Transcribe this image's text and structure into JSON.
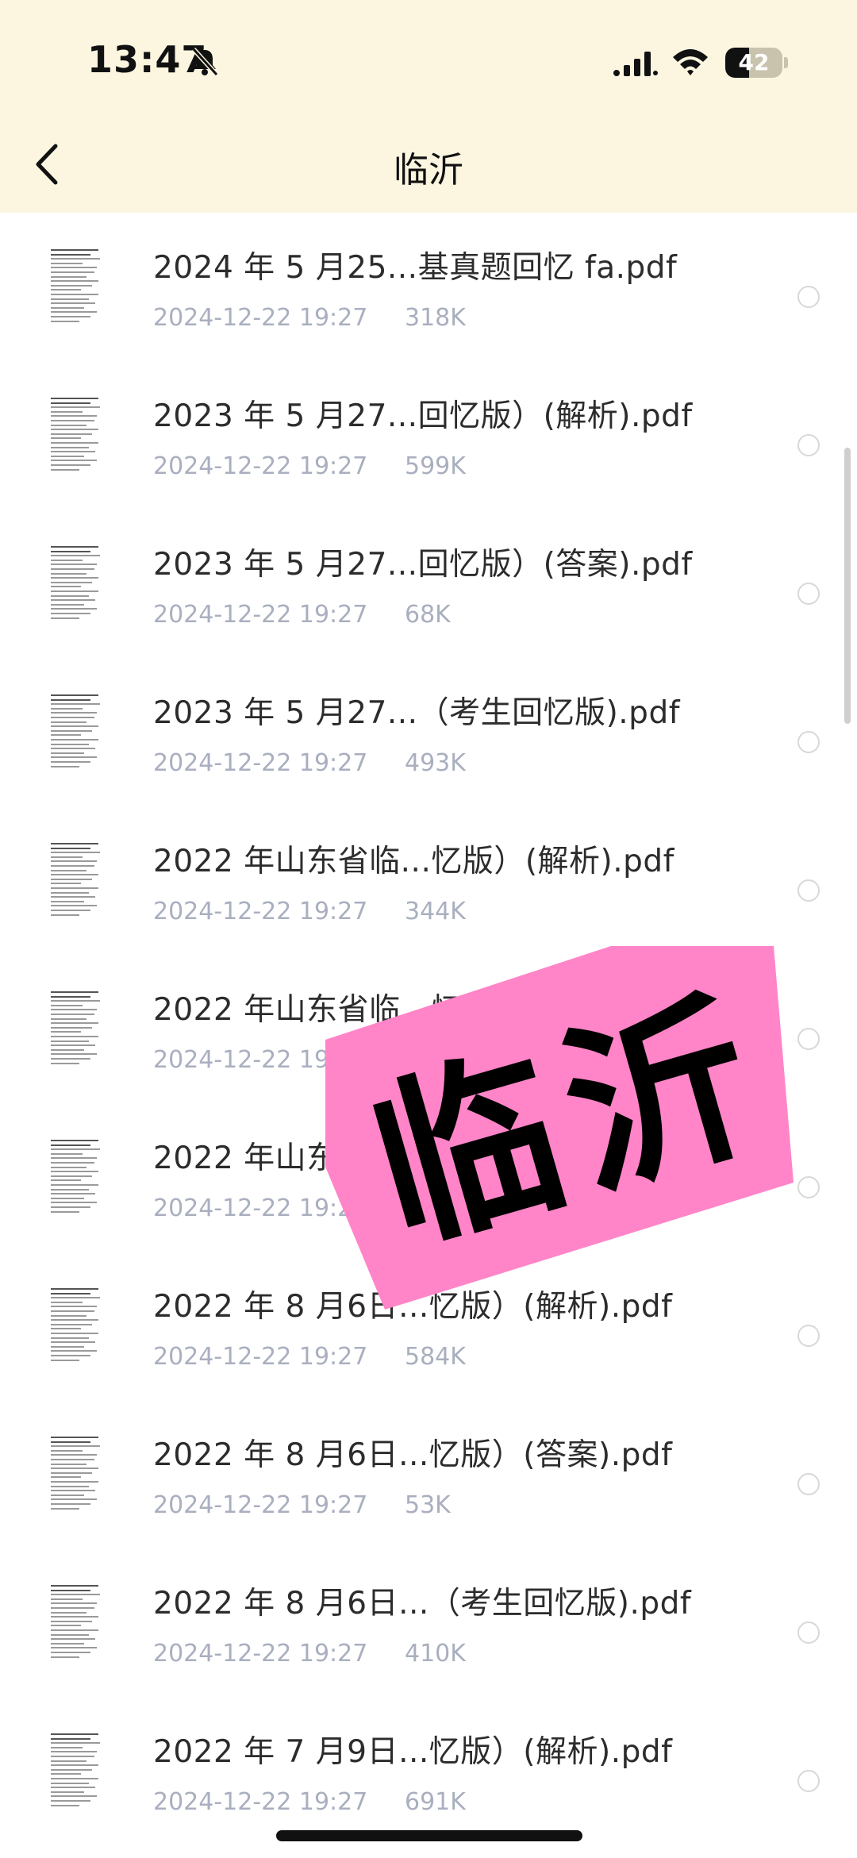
{
  "status_bar": {
    "time": "13:47",
    "battery_level": "42"
  },
  "nav": {
    "title": "临沂"
  },
  "files": [
    {
      "name": "2024 年 5 月25...基真题回忆 fa.pdf",
      "date": "2024-12-22 19:27",
      "size": "318K"
    },
    {
      "name": "2023 年 5 月27...回忆版）(解析).pdf",
      "date": "2024-12-22 19:27",
      "size": "599K"
    },
    {
      "name": "2023 年 5 月27...回忆版）(答案).pdf",
      "date": "2024-12-22 19:27",
      "size": "68K"
    },
    {
      "name": "2023 年 5 月27...（考生回忆版).pdf",
      "date": "2024-12-22 19:27",
      "size": "493K"
    },
    {
      "name": "2022 年山东省临...忆版）(解析).pdf",
      "date": "2024-12-22 19:27",
      "size": "344K"
    },
    {
      "name": "2022 年山东省临...忆版）(答案).pdf",
      "date": "2024-12-22 19:27",
      "size": ""
    },
    {
      "name": "2022 年山东省临...（考生回忆版).pdf",
      "date": "2024-12-22 19:27",
      "size": ""
    },
    {
      "name": "2022 年 8 月6日...忆版）(解析).pdf",
      "date": "2024-12-22 19:27",
      "size": "584K"
    },
    {
      "name": "2022 年 8 月6日...忆版）(答案).pdf",
      "date": "2024-12-22 19:27",
      "size": "53K"
    },
    {
      "name": "2022 年 8 月6日...（考生回忆版).pdf",
      "date": "2024-12-22 19:27",
      "size": "410K"
    },
    {
      "name": "2022 年 7 月9日...忆版）(解析).pdf",
      "date": "2024-12-22 19:27",
      "size": "691K"
    }
  ],
  "sticker": {
    "text": "临沂",
    "color": "#ff85c8"
  },
  "colors": {
    "header_bg": "#fcf6e0",
    "meta_text": "#a9afbf"
  }
}
